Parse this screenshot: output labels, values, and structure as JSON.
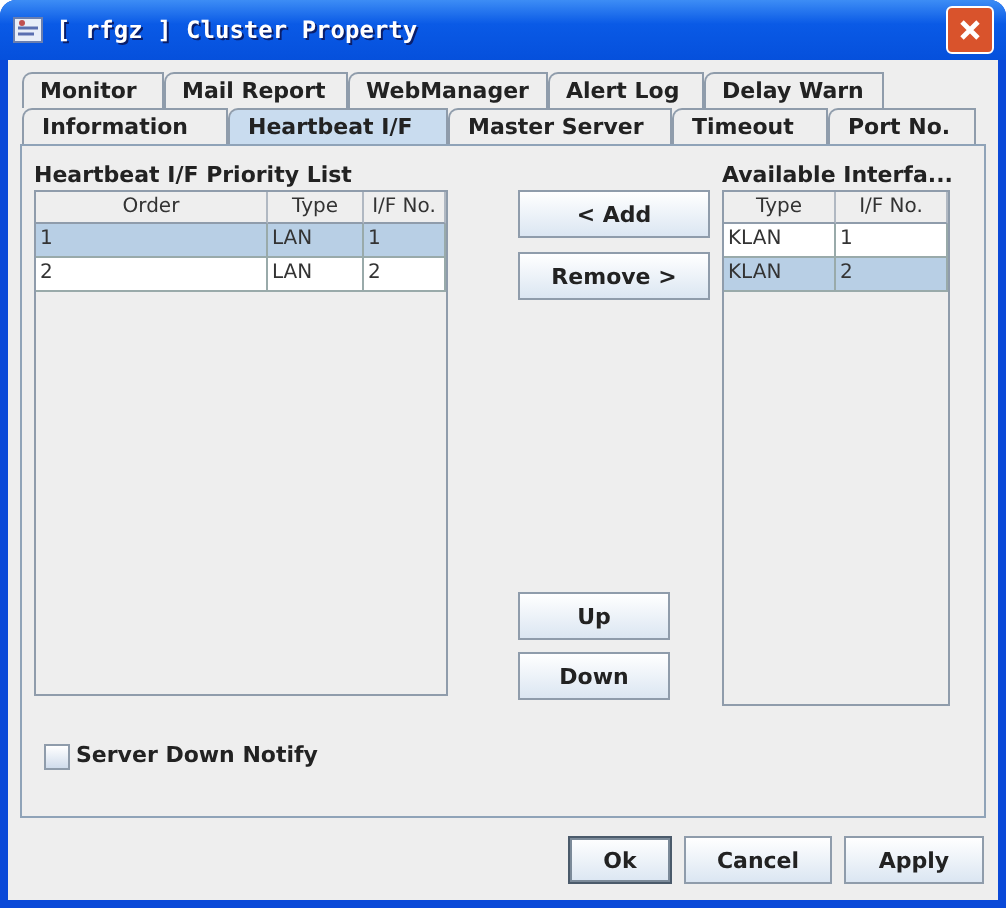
{
  "window": {
    "title": "[ rfgz ] Cluster Property"
  },
  "tab_rows": [
    [
      {
        "label": "Monitor",
        "selected": false
      },
      {
        "label": "Mail Report",
        "selected": false
      },
      {
        "label": "WebManager",
        "selected": false
      },
      {
        "label": "Alert Log",
        "selected": false
      },
      {
        "label": "Delay Warn",
        "selected": false
      }
    ],
    [
      {
        "label": "Information",
        "selected": false
      },
      {
        "label": "Heartbeat I/F",
        "selected": true
      },
      {
        "label": "Master Server",
        "selected": false
      },
      {
        "label": "Timeout",
        "selected": false
      },
      {
        "label": "Port No.",
        "selected": false
      }
    ]
  ],
  "priority_list": {
    "title": "Heartbeat I/F Priority List",
    "columns": [
      "Order",
      "Type",
      "I/F No."
    ],
    "rows": [
      {
        "cells": [
          "1",
          "LAN",
          "1"
        ],
        "selected": true
      },
      {
        "cells": [
          "2",
          "LAN",
          "2"
        ],
        "selected": false
      }
    ]
  },
  "move_buttons": [
    {
      "label": "< Add"
    },
    {
      "label": "Remove >"
    }
  ],
  "order_buttons": [
    {
      "label": "Up"
    },
    {
      "label": "Down"
    }
  ],
  "available_list": {
    "title": "Available Interfa...",
    "columns": [
      "Type",
      "I/F No."
    ],
    "rows": [
      {
        "cells": [
          "KLAN",
          "1"
        ],
        "selected": false
      },
      {
        "cells": [
          "KLAN",
          "2"
        ],
        "selected": true
      }
    ]
  },
  "server_down_notify": {
    "label": "Server Down Notify",
    "checked": false
  },
  "buttons": [
    {
      "label": "Ok",
      "focused": true
    },
    {
      "label": "Cancel",
      "focused": false
    },
    {
      "label": "Apply",
      "focused": false
    }
  ]
}
